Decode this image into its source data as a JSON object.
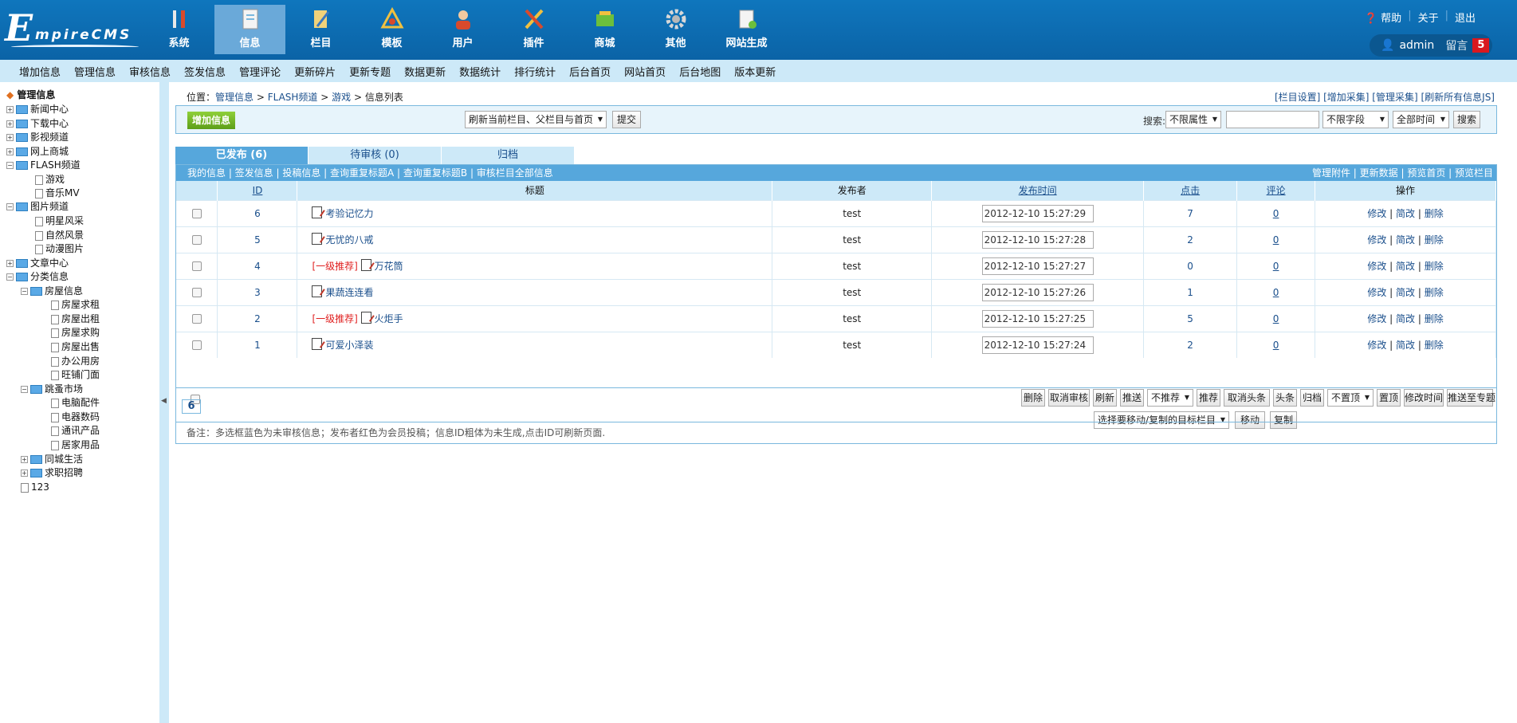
{
  "logo": {
    "big": "E",
    "rest": "mpireCMS"
  },
  "nav": [
    "系统",
    "信息",
    "栏目",
    "模板",
    "用户",
    "插件",
    "商城",
    "其他",
    "网站生成"
  ],
  "toplinks": {
    "help": "帮助",
    "about": "关于",
    "logout": "退出"
  },
  "user": {
    "name": "admin",
    "msg_label": "留言",
    "msg_count": "5"
  },
  "subnav": [
    "增加信息",
    "管理信息",
    "审核信息",
    "签发信息",
    "管理评论",
    "更新碎片",
    "更新专题",
    "数据更新",
    "数据统计",
    "排行统计",
    "后台首页",
    "网站首页",
    "后台地图",
    "版本更新"
  ],
  "tree": [
    "管理信息",
    "新闻中心",
    "下载中心",
    "影视频道",
    "网上商城",
    "FLASH频道",
    "游戏",
    "音乐MV",
    "图片频道",
    "明星风采",
    "自然风景",
    "动漫图片",
    "文章中心",
    "分类信息",
    "房屋信息",
    "房屋求租",
    "房屋出租",
    "房屋求购",
    "房屋出售",
    "办公用房",
    "旺铺门面",
    "跳蚤市场",
    "电脑配件",
    "电器数码",
    "通讯产品",
    "居家用品",
    "同城生活",
    "求职招聘",
    "123"
  ],
  "location": {
    "label": "位置：",
    "crumb1": "管理信息",
    "sep": " > ",
    "crumb2": "FLASH频道",
    "crumb3": "游戏",
    "current": "信息列表"
  },
  "rightlinks": "[栏目设置] [增加采集] [管理采集] [刷新所有信息JS]",
  "toolbar": {
    "add": "增加信息",
    "refresh_select": "刷新当前栏目、父栏目与首页",
    "submit": "提交",
    "search_label": "搜索:",
    "attr_select": "不限属性",
    "field_select": "不限字段",
    "time_select": "全部时间",
    "search_btn": "搜索"
  },
  "tabs": [
    "已发布 (6)",
    "待审核 (0)",
    "归档"
  ],
  "gridtop": {
    "left": "我的信息 | 签发信息 | 投稿信息 | 查询重复标题A | 查询重复标题B | 审核栏目全部信息",
    "right": "管理附件 | 更新数据 | 预览首页 | 预览栏目"
  },
  "columns": [
    "ID",
    "标题",
    "发布者",
    "发布时间",
    "点击",
    "评论",
    "操作"
  ],
  "rows": [
    {
      "id": "6",
      "rec": "",
      "title": "考验记忆力",
      "user": "test",
      "time": "2012-12-10 15:27:29",
      "clicks": "7",
      "comments": "0"
    },
    {
      "id": "5",
      "rec": "",
      "title": "无忧的八戒",
      "user": "test",
      "time": "2012-12-10 15:27:28",
      "clicks": "2",
      "comments": "0"
    },
    {
      "id": "4",
      "rec": "[一级推荐]",
      "title": "万花筒",
      "user": "test",
      "time": "2012-12-10 15:27:27",
      "clicks": "0",
      "comments": "0"
    },
    {
      "id": "3",
      "rec": "",
      "title": "果蔬连连看",
      "user": "test",
      "time": "2012-12-10 15:27:26",
      "clicks": "1",
      "comments": "0"
    },
    {
      "id": "2",
      "rec": "[一级推荐]",
      "title": "火炬手",
      "user": "test",
      "time": "2012-12-10 15:27:25",
      "clicks": "5",
      "comments": "0"
    },
    {
      "id": "1",
      "rec": "",
      "title": "可爱小泽装",
      "user": "test",
      "time": "2012-12-10 15:27:24",
      "clicks": "2",
      "comments": "0"
    }
  ],
  "ops": {
    "edit": "修改",
    "simple": "简改",
    "del": "删除",
    "sep": " | "
  },
  "actions": [
    "删除",
    "取消审核",
    "刷新",
    "推送",
    "不推荐",
    "推荐",
    "取消头条",
    "头条",
    "归档",
    "不置顶",
    "置顶",
    "修改时间",
    "推送至专题"
  ],
  "move": {
    "select": "选择要移动/复制的目标栏目",
    "move": "移动",
    "copy": "复制"
  },
  "page_total": "6",
  "note": "备注：多选框蓝色为未审核信息；发布者红色为会员投稿；信息ID粗体为未生成,点击ID可刷新页面."
}
